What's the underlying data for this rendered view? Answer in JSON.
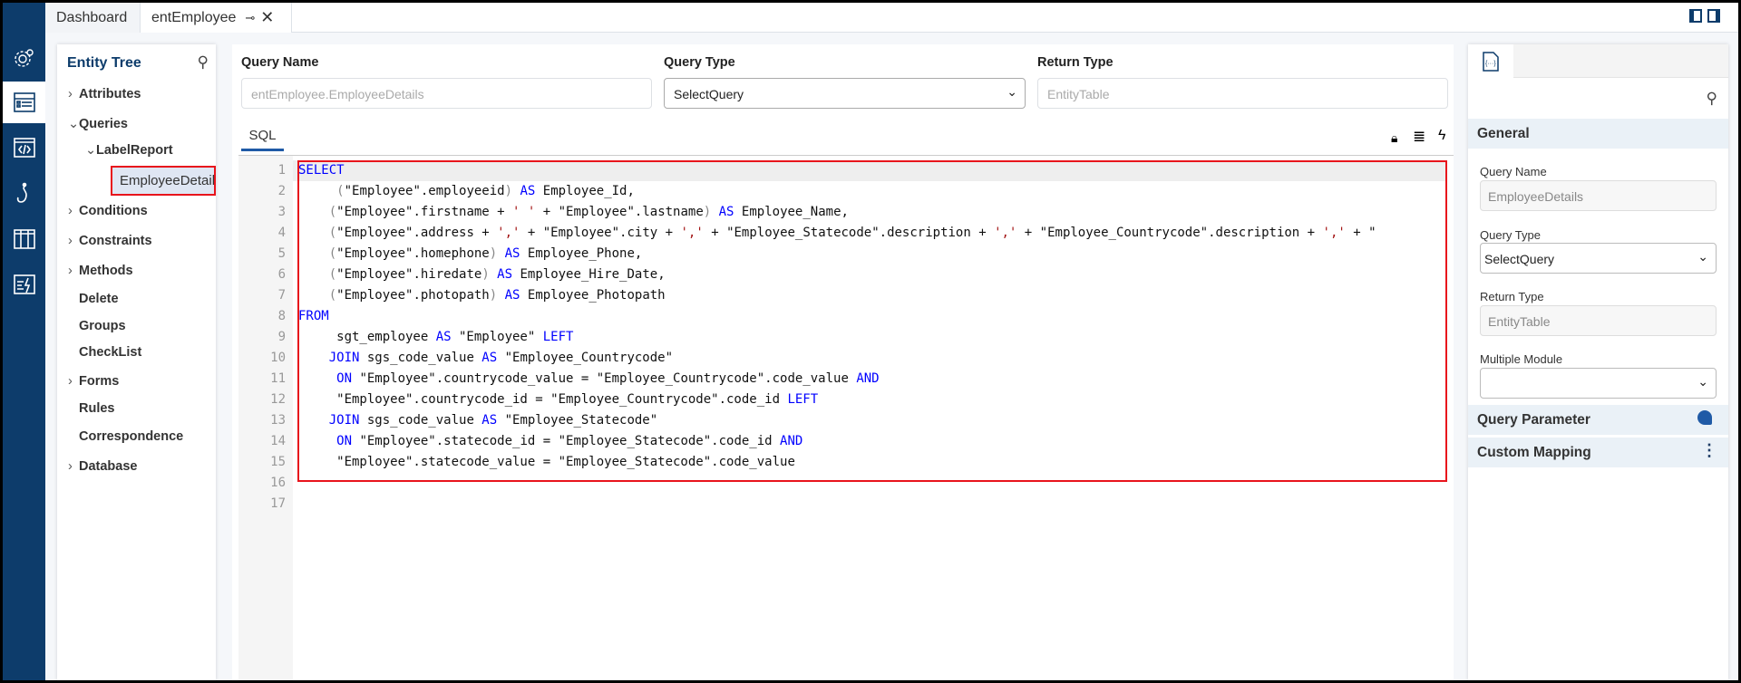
{
  "tabs": [
    {
      "label": "Dashboard"
    },
    {
      "label": "entEmployee"
    }
  ],
  "sidebar": {
    "icons": [
      "gear-icon",
      "entity-list-icon",
      "code-icon",
      "hook-icon",
      "table-columns-icon",
      "rules-icon"
    ]
  },
  "tree": {
    "title": "Entity Tree",
    "items": [
      {
        "label": "Attributes",
        "chevron": "right"
      },
      {
        "label": "Queries",
        "chevron": "down"
      },
      {
        "label": "LabelReport",
        "chevron": "down"
      },
      {
        "label": "EmployeeDetails",
        "selected": true
      },
      {
        "label": "Conditions",
        "chevron": "right"
      },
      {
        "label": "Constraints",
        "chevron": "right"
      },
      {
        "label": "Methods",
        "chevron": "right"
      },
      {
        "label": "Delete"
      },
      {
        "label": "Groups"
      },
      {
        "label": "CheckList"
      },
      {
        "label": "Forms",
        "chevron": "right"
      },
      {
        "label": "Rules"
      },
      {
        "label": "Correspondence"
      },
      {
        "label": "Database",
        "chevron": "right"
      }
    ]
  },
  "form": {
    "query_name_label": "Query Name",
    "query_name_value": "entEmployee.EmployeeDetails",
    "query_type_label": "Query Type",
    "query_type_value": "SelectQuery",
    "return_type_label": "Return Type",
    "return_type_value": "EntityTable"
  },
  "editor": {
    "tab": "SQL",
    "line_numbers": [
      "1",
      "2",
      "3",
      "4",
      "5",
      "6",
      "7",
      "8",
      "9",
      "10",
      "11",
      "12",
      "13",
      "14",
      "15",
      "16",
      "17"
    ],
    "lines": [
      [
        [
          "kw",
          "SELECT"
        ]
      ],
      [
        [
          "",
          "     "
        ],
        [
          "pn",
          "("
        ],
        [
          "",
          "\"Employee\".employeeid"
        ],
        [
          "pn",
          ")"
        ],
        [
          "",
          ""
        ],
        [
          "kw",
          " AS"
        ],
        [
          "",
          " Employee_Id,"
        ]
      ],
      [
        [
          "",
          "    "
        ],
        [
          "pn",
          "("
        ],
        [
          "",
          "\"Employee\".firstname + "
        ],
        [
          "str",
          "' '"
        ],
        [
          "",
          " + \"Employee\".lastname"
        ],
        [
          "pn",
          ")"
        ],
        [
          "kw",
          " AS"
        ],
        [
          "",
          " Employee_Name,"
        ]
      ],
      [
        [
          "",
          "    "
        ],
        [
          "pn",
          "("
        ],
        [
          "",
          "\"Employee\".address + "
        ],
        [
          "str",
          "','"
        ],
        [
          "",
          " + \"Employee\".city + "
        ],
        [
          "str",
          "','"
        ],
        [
          "",
          " + \"Employee_Statecode\".description + "
        ],
        [
          "str",
          "','"
        ],
        [
          "",
          " + \"Employee_Countrycode\".description + "
        ],
        [
          "str",
          "','"
        ],
        [
          "",
          " + \""
        ]
      ],
      [
        [
          "",
          "    "
        ],
        [
          "pn",
          "("
        ],
        [
          "",
          "\"Employee\".homephone"
        ],
        [
          "pn",
          ")"
        ],
        [
          "kw",
          " AS"
        ],
        [
          "",
          " Employee_Phone,"
        ]
      ],
      [
        [
          "",
          "    "
        ],
        [
          "pn",
          "("
        ],
        [
          "",
          "\"Employee\".hiredate"
        ],
        [
          "pn",
          ")"
        ],
        [
          "kw",
          " AS"
        ],
        [
          "",
          " Employee_Hire_Date,"
        ]
      ],
      [
        [
          "",
          "    "
        ],
        [
          "pn",
          "("
        ],
        [
          "",
          "\"Employee\".photopath"
        ],
        [
          "pn",
          ")"
        ],
        [
          "kw",
          " AS"
        ],
        [
          "",
          " Employee_Photopath"
        ]
      ],
      [
        [
          "kw",
          "FROM"
        ]
      ],
      [
        [
          "",
          "     sgt_employee "
        ],
        [
          "kw",
          "AS"
        ],
        [
          "",
          " \"Employee\" "
        ],
        [
          "kw",
          "LEFT"
        ]
      ],
      [
        [
          "",
          "    "
        ],
        [
          "kw",
          "JOIN"
        ],
        [
          "",
          " sgs_code_value "
        ],
        [
          "kw",
          "AS"
        ],
        [
          "",
          " \"Employee_Countrycode\""
        ]
      ],
      [
        [
          "",
          "     "
        ],
        [
          "kw",
          "ON"
        ],
        [
          "",
          " \"Employee\".countrycode_value = \"Employee_Countrycode\".code_value "
        ],
        [
          "kw",
          "AND"
        ]
      ],
      [
        [
          "",
          "     \"Employee\".countrycode_id = \"Employee_Countrycode\".code_id "
        ],
        [
          "kw",
          "LEFT"
        ]
      ],
      [
        [
          "",
          "    "
        ],
        [
          "kw",
          "JOIN"
        ],
        [
          "",
          " sgs_code_value "
        ],
        [
          "kw",
          "AS"
        ],
        [
          "",
          " \"Employee_Statecode\""
        ]
      ],
      [
        [
          "",
          "     "
        ],
        [
          "kw",
          "ON"
        ],
        [
          "",
          " \"Employee\".statecode_id = \"Employee_Statecode\".code_id "
        ],
        [
          "kw",
          "AND"
        ]
      ],
      [
        [
          "",
          "     \"Employee\".statecode_value = \"Employee_Statecode\".code_value"
        ]
      ],
      [],
      []
    ]
  },
  "panel": {
    "general": "General",
    "query_name_label": "Query Name",
    "query_name_value": "EmployeeDetails",
    "query_type_label": "Query Type",
    "query_type_value": "SelectQuery",
    "return_type_label": "Return Type",
    "return_type_value": "EntityTable",
    "multiple_module_label": "Multiple Module",
    "multiple_module_value": "",
    "query_parameter": "Query Parameter",
    "custom_mapping": "Custom Mapping"
  },
  "colors": {
    "sidebar": "#0d3c6b",
    "highlight": "#e8141c",
    "keyword": "#0000ff",
    "string": "#a31515"
  }
}
